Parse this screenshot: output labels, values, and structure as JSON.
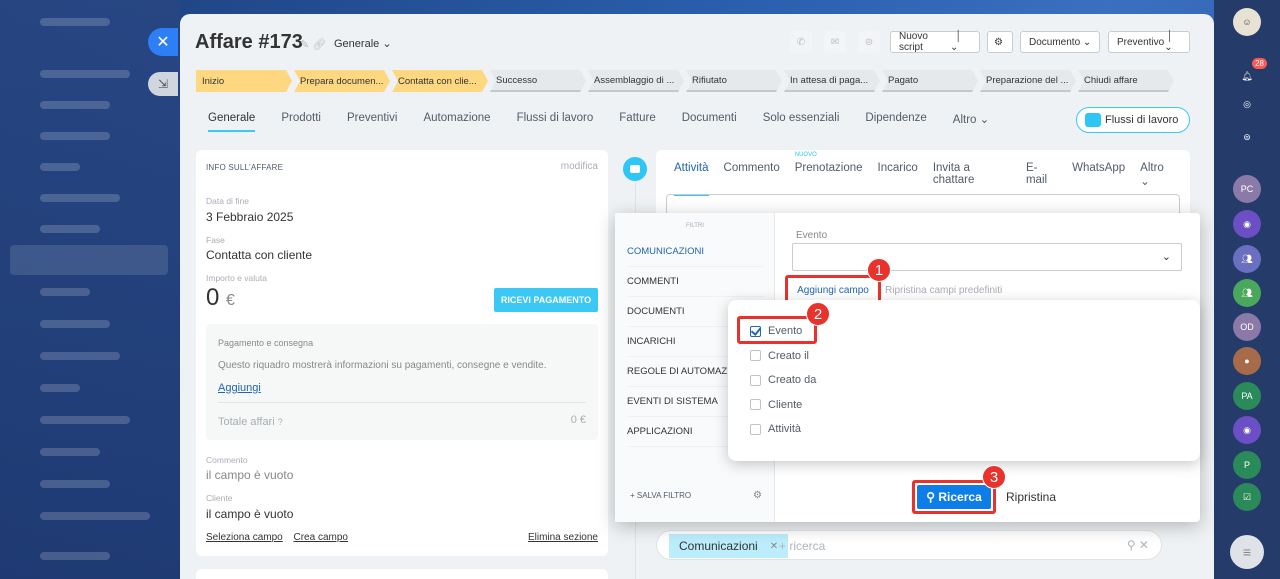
{
  "deal": {
    "title": "Affare #173",
    "category": "Generale"
  },
  "toolbar": {
    "script": "Nuovo script",
    "document": "Documento",
    "quote": "Preventivo"
  },
  "stages": [
    {
      "label": "Inizio",
      "done": true,
      "w": 96
    },
    {
      "label": "Prepara documen...",
      "done": true,
      "w": 96
    },
    {
      "label": "Contatta con clie...",
      "done": true,
      "w": 96
    },
    {
      "label": "Successo",
      "done": false,
      "w": 96
    },
    {
      "label": "Assemblaggio di ...",
      "done": false,
      "w": 96
    },
    {
      "label": "Rifiutato",
      "done": false,
      "w": 96
    },
    {
      "label": "In attesa di paga...",
      "done": false,
      "w": 96
    },
    {
      "label": "Pagato",
      "done": false,
      "w": 96
    },
    {
      "label": "Preparazione del ...",
      "done": false,
      "w": 96
    },
    {
      "label": "Chiudi affare",
      "done": false,
      "w": 96
    }
  ],
  "tabs": [
    "Generale",
    "Prodotti",
    "Preventivi",
    "Automazione",
    "Flussi di lavoro",
    "Fatture",
    "Documenti",
    "Solo essenziali",
    "Dipendenze",
    "Altro ⌄"
  ],
  "flow_button": "Flussi di lavoro",
  "card": {
    "header": "INFO SULL'AFFARE",
    "edit": "modifica",
    "end_date_label": "Data di fine",
    "end_date": "3 Febbraio 2025",
    "stage_label": "Fase",
    "stage": "Contatta con cliente",
    "amount_label": "Importo e valuta",
    "amount": "0",
    "currency": "€",
    "pay_button": "RICEVI PAGAMENTO",
    "pay_title": "Pagamento e consegna",
    "pay_desc": "Questo riquadro mostrerà informazioni su pagamenti, consegne e vendite.",
    "pay_add": "Aggiungi",
    "total_label": "Totale affari",
    "total_value": "0 €",
    "comment_label": "Commento",
    "comment_value": "il campo è vuoto",
    "client_label": "Cliente",
    "client_value": "il campo è vuoto",
    "select_field": "Seleziona campo",
    "create_field": "Crea campo",
    "delete_section": "Elimina sezione"
  },
  "activity": {
    "new_badge": "NUOVO",
    "tabs": [
      "Attività",
      "Commento",
      "Prenotazione",
      "Incarico",
      "Invita a chattare",
      "E-mail",
      "WhatsApp",
      "Altro ⌄"
    ]
  },
  "filter": {
    "header": "FILTRI",
    "items": [
      "COMUNICAZIONI",
      "COMMENTI",
      "DOCUMENTI",
      "INCARICHI",
      "REGOLE DI AUTOMAZIONE",
      "EVENTI DI SISTEMA",
      "APPLICAZIONI"
    ],
    "save": "+ SALVA FILTRO",
    "event_label": "Evento",
    "add_field": "Aggiungi campo",
    "reset_fields": "Ripristina campi predefiniti",
    "fields": [
      {
        "label": "Evento",
        "checked": true
      },
      {
        "label": "Creato il",
        "checked": false
      },
      {
        "label": "Creato da",
        "checked": false
      },
      {
        "label": "Cliente",
        "checked": false
      },
      {
        "label": "Attività",
        "checked": false
      }
    ],
    "search": "Ricerca",
    "reset": "Ripristina"
  },
  "searchbar": {
    "chip": "Comunicazioni",
    "placeholder": "+ ricerca"
  },
  "steps": [
    "1",
    "2",
    "3"
  ],
  "right_nav": {
    "badge": "28",
    "avatars": [
      "PC",
      "OD",
      "PA",
      "P"
    ]
  }
}
